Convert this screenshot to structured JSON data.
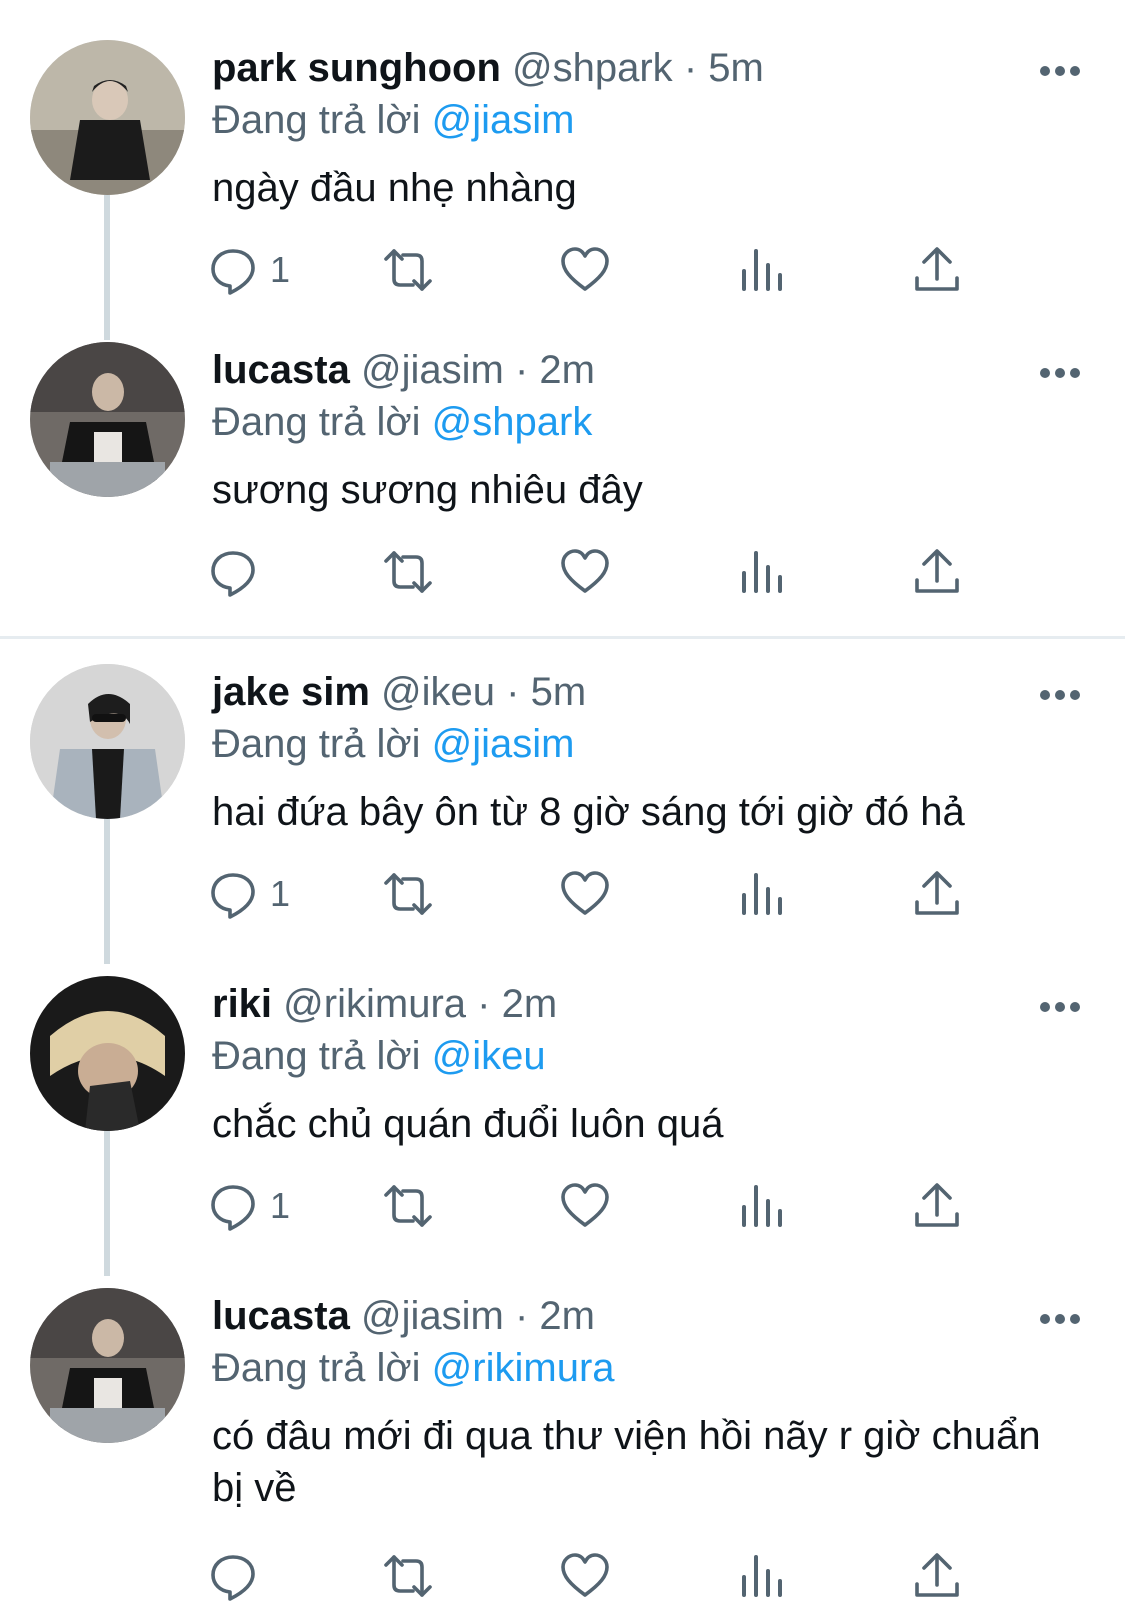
{
  "colors": {
    "accent": "#1d9bf0",
    "muted": "#536471",
    "text": "#0f1419",
    "thread": "#cfd9de"
  },
  "reply_prefix": "Đang trả lời",
  "tweets": [
    {
      "name": "park sunghoon",
      "handle": "@shpark",
      "sep": "·",
      "time": "5m",
      "reply_to": "@jiasim",
      "text": "ngày đầu nhẹ nhàng",
      "reply_count": "1",
      "avatar_icon": "avatar-photo"
    },
    {
      "name": "lucasta",
      "handle": "@jiasim",
      "sep": "·",
      "time": "2m",
      "reply_to": "@shpark",
      "text": "sương sương nhiêu đây",
      "reply_count": "",
      "avatar_icon": "avatar-photo"
    },
    {
      "name": "jake sim",
      "handle": "@ikeu",
      "sep": "·",
      "time": "5m",
      "reply_to": "@jiasim",
      "text": "hai đứa bây ôn từ 8 giờ sáng tới giờ đó hả",
      "reply_count": "1",
      "avatar_icon": "avatar-photo"
    },
    {
      "name": "riki",
      "handle": "@rikimura",
      "sep": "·",
      "time": "2m",
      "reply_to": "@ikeu",
      "text": "chắc chủ quán đuổi luôn quá",
      "reply_count": "1",
      "avatar_icon": "avatar-photo"
    },
    {
      "name": "lucasta",
      "handle": "@jiasim",
      "sep": "·",
      "time": "2m",
      "reply_to": "@rikimura",
      "text": "có đâu mới đi qua thư viện hồi nãy r giờ chuẩn bị về",
      "reply_count": "",
      "avatar_icon": "avatar-photo"
    }
  ],
  "icons": [
    "reply-icon",
    "retweet-icon",
    "like-icon",
    "views-icon",
    "share-icon",
    "more-icon"
  ]
}
